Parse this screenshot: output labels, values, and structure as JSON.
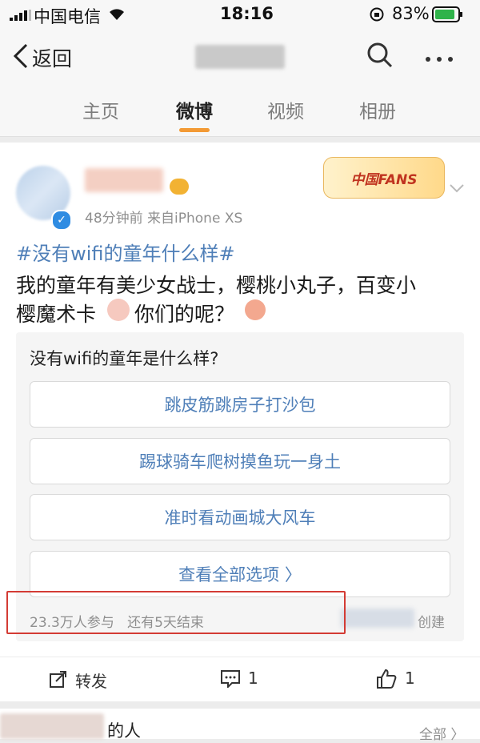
{
  "status_bar": {
    "carrier": "中国电信",
    "time": "18:16",
    "battery": "83%"
  },
  "nav": {
    "back_label": "返回"
  },
  "tabs": [
    {
      "label": "主页"
    },
    {
      "label": "微博"
    },
    {
      "label": "视频"
    },
    {
      "label": "相册"
    }
  ],
  "post": {
    "meta": "48分钟前  来自iPhone XS",
    "badge_text": "中国FANS",
    "topic": "#没有wifi的童年什么样#",
    "body_line1": "我的童年有美少女战士，樱桃小丸子，百变小",
    "body_line2a": "樱魔术卡",
    "body_line2b": "你们的呢？",
    "poll": {
      "question": "没有wifi的童年是什么样?",
      "options": [
        "跳皮筋跳房子打沙包",
        "踢球骑车爬树摸鱼玩一身土",
        "准时看动画城大风车"
      ],
      "view_all": "查看全部选项 〉",
      "participants": "23.3万人参与",
      "remaining": "还有5天结束",
      "creator_suffix": "创建"
    },
    "actions": {
      "repost": "转发",
      "comments": "1",
      "likes": "1"
    }
  },
  "bottom": {
    "partial_text": "的人",
    "all_label": "全部 〉"
  },
  "colors": {
    "accent_orange": "#f39a35",
    "link_blue": "#4f7fb8",
    "highlight_red": "#d33b34"
  }
}
